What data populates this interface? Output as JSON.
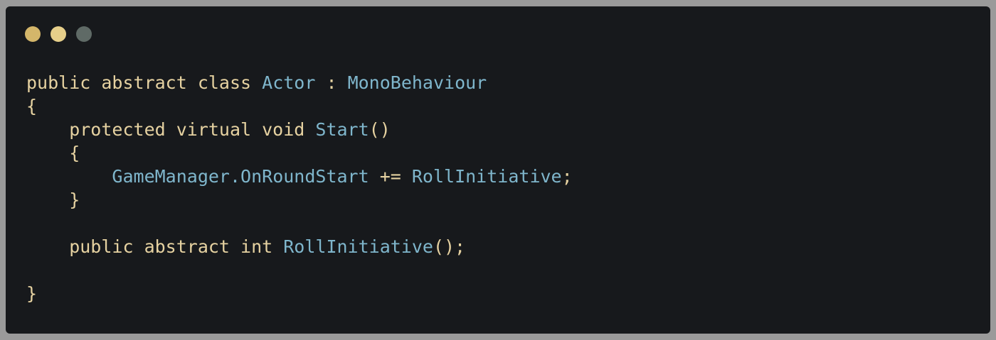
{
  "window": {
    "controls": [
      {
        "name": "close",
        "color": "#d4b66a"
      },
      {
        "name": "minimize",
        "color": "#e6cf8a"
      },
      {
        "name": "maximize",
        "color": "#5f6a66"
      }
    ]
  },
  "colors": {
    "background": "#17191c",
    "keyword": "#e6d2a1",
    "identifier": "#7fb6cc"
  },
  "code": {
    "lines": [
      [
        {
          "t": "kw",
          "v": "public abstract class "
        },
        {
          "t": "type",
          "v": "Actor"
        },
        {
          "t": "punc",
          "v": " : "
        },
        {
          "t": "type",
          "v": "MonoBehaviour"
        }
      ],
      [
        {
          "t": "punc",
          "v": "{"
        }
      ],
      [
        {
          "t": "kw",
          "v": "    protected virtual void "
        },
        {
          "t": "type",
          "v": "Start"
        },
        {
          "t": "punc",
          "v": "()"
        }
      ],
      [
        {
          "t": "punc",
          "v": "    {"
        }
      ],
      [
        {
          "t": "punc",
          "v": "        "
        },
        {
          "t": "type",
          "v": "GameManager.OnRoundStart"
        },
        {
          "t": "punc",
          "v": " += "
        },
        {
          "t": "type",
          "v": "RollInitiative"
        },
        {
          "t": "punc",
          "v": ";"
        }
      ],
      [
        {
          "t": "punc",
          "v": "    }"
        }
      ],
      [],
      [
        {
          "t": "kw",
          "v": "    public abstract int "
        },
        {
          "t": "type",
          "v": "RollInitiative"
        },
        {
          "t": "punc",
          "v": "();"
        }
      ],
      [],
      [
        {
          "t": "punc",
          "v": "}"
        }
      ]
    ]
  }
}
